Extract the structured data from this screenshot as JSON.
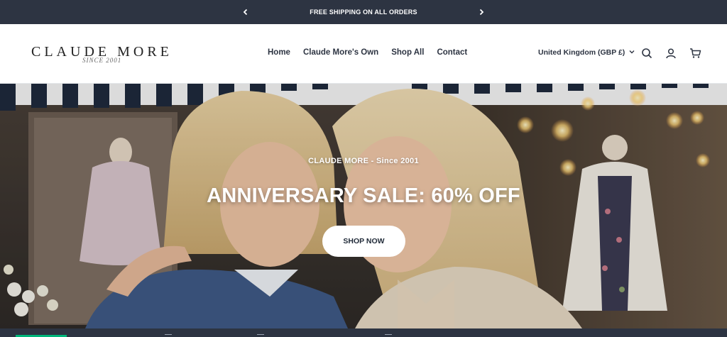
{
  "announcement": {
    "text": "FREE SHIPPING ON ALL ORDERS",
    "prev_icon": "chevron-left-icon",
    "next_icon": "chevron-right-icon"
  },
  "header": {
    "logo": {
      "name": "CLAUDE MORE",
      "tagline": "SINCE 2001"
    },
    "nav": [
      {
        "label": "Home"
      },
      {
        "label": "Claude More's Own"
      },
      {
        "label": "Shop All"
      },
      {
        "label": "Contact"
      }
    ],
    "locale": "United Kingdom (GBP £)",
    "icons": [
      "search-icon",
      "account-icon",
      "cart-icon"
    ]
  },
  "hero": {
    "kicker": "CLAUDE MORE - Since 2001",
    "headline": "ANNIVERSARY SALE: 60% OFF",
    "cta": "SHOP NOW"
  },
  "colors": {
    "announcement_bg": "#2d3442",
    "accent_green": "#00b67a",
    "text_dark": "#2d3442"
  }
}
